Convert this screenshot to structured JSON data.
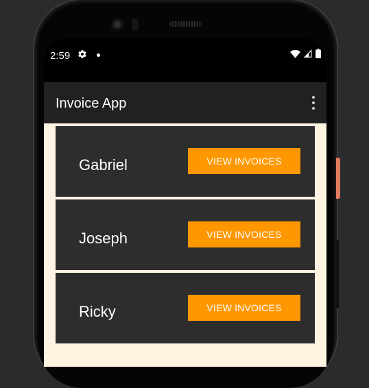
{
  "status_bar": {
    "time": "2:59",
    "icons": [
      "gear-icon",
      "notification-dot",
      "wifi-icon",
      "signal-icon",
      "battery-icon"
    ]
  },
  "app_bar": {
    "title": "Invoice App",
    "overflow_icon": "more-vert-icon"
  },
  "customers": [
    {
      "name": "Gabriel",
      "button_label": "VIEW INVOICES"
    },
    {
      "name": "Joseph",
      "button_label": "VIEW INVOICES"
    },
    {
      "name": "Ricky",
      "button_label": "VIEW INVOICES"
    }
  ],
  "colors": {
    "accent": "#ff9800",
    "card": "#2d2d2d",
    "background": "#fff3e2",
    "appbar": "#212121"
  }
}
